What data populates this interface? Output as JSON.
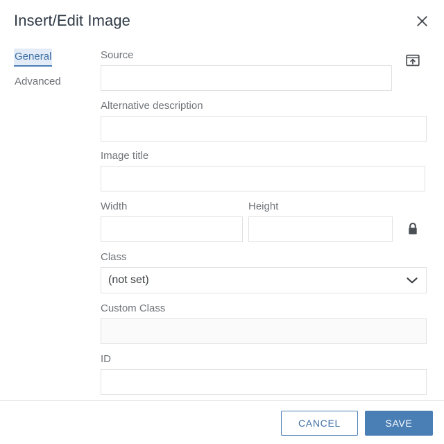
{
  "dialog": {
    "title": "Insert/Edit Image",
    "close_icon": "close-icon"
  },
  "tabs": [
    {
      "label": "General",
      "active": true
    },
    {
      "label": "Advanced",
      "active": false
    }
  ],
  "form": {
    "source": {
      "label": "Source",
      "value": "",
      "placeholder": "",
      "browse_icon": "upload-image-icon"
    },
    "alt_description": {
      "label": "Alternative description",
      "value": "",
      "placeholder": ""
    },
    "image_title": {
      "label": "Image title",
      "value": "",
      "placeholder": ""
    },
    "width": {
      "label": "Width",
      "value": "",
      "placeholder": ""
    },
    "height": {
      "label": "Height",
      "value": "",
      "placeholder": ""
    },
    "constrain": {
      "icon": "lock-closed-icon"
    },
    "class": {
      "label": "Class",
      "selected": "(not set)",
      "chevron_icon": "chevron-down-icon"
    },
    "custom_class": {
      "label": "Custom Class",
      "value": "",
      "placeholder": "",
      "disabled": true
    },
    "id": {
      "label": "ID",
      "value": "",
      "placeholder": ""
    }
  },
  "footer": {
    "cancel_label": "CANCEL",
    "save_label": "SAVE"
  },
  "colors": {
    "accent": "#4a7fb5",
    "accent_text": "#3d6fa5",
    "tab_active_bg": "#e3ecf6",
    "label": "#70757a",
    "title": "#2f3a45",
    "border": "#dfe1e3"
  }
}
